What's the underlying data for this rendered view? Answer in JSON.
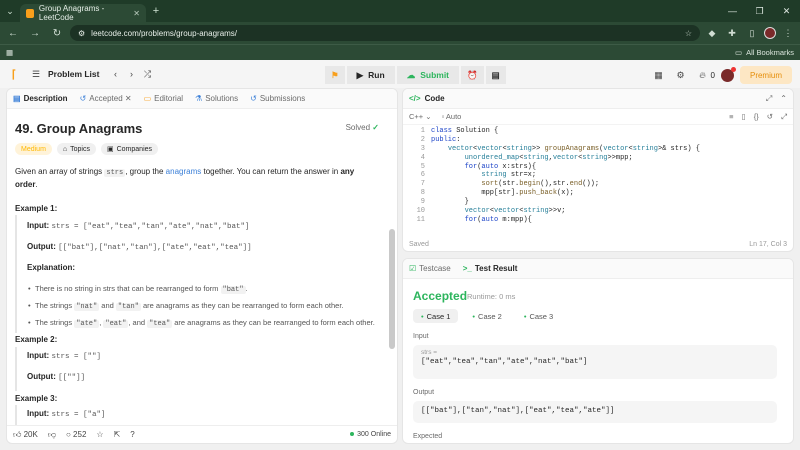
{
  "browser": {
    "tab_title": "Group Anagrams - LeetCode",
    "url": "leetcode.com/problems/group-anagrams/",
    "all_bookmarks": "All Bookmarks"
  },
  "topbar": {
    "problem_list": "Problem List",
    "run": "Run",
    "submit": "Submit",
    "streak": "0",
    "premium": "Premium"
  },
  "left": {
    "tabs": [
      "Description",
      "Accepted",
      "Editorial",
      "Solutions",
      "Submissions"
    ],
    "title": "49. Group Anagrams",
    "solved": "Solved",
    "difficulty": "Medium",
    "topics": "Topics",
    "companies": "Companies",
    "desc_1": "Given an array of strings ",
    "desc_code": "strs",
    "desc_2": ", group the ",
    "desc_link": "anagrams",
    "desc_3": " together. You can return the answer in ",
    "desc_bold": "any order",
    "desc_4": ".",
    "ex1_h": "Example 1:",
    "ex1_input_label": "Input:",
    "ex1_input": "strs = [\"eat\",\"tea\",\"tan\",\"ate\",\"nat\",\"bat\"]",
    "ex1_output_label": "Output:",
    "ex1_output": "[[\"bat\"],[\"nat\",\"tan\"],[\"ate\",\"eat\",\"tea\"]]",
    "ex1_expl": "Explanation:",
    "b1_a": "There is no string in strs that can be rearranged to form ",
    "b1_c": "\"bat\"",
    "b1_b": ".",
    "b2_a": "The strings ",
    "b2_c1": "\"nat\"",
    "b2_m": " and ",
    "b2_c2": "\"tan\"",
    "b2_b": " are anagrams as they can be rearranged to form each other.",
    "b3_a": "The strings ",
    "b3_c1": "\"ate\"",
    "b3_s": ", ",
    "b3_c2": "\"eat\"",
    "b3_m": ", and ",
    "b3_c3": "\"tea\"",
    "b3_b": " are anagrams as they can be rearranged to form each other.",
    "ex2_h": "Example 2:",
    "ex2_input_label": "Input:",
    "ex2_input": "strs = [\"\"]",
    "ex2_output_label": "Output:",
    "ex2_output": "[[\"\"]]",
    "ex3_h": "Example 3:",
    "ex3_input_label": "Input:",
    "ex3_input": "strs = [\"a\"]",
    "likes": "20K",
    "comments": "252",
    "online": "300 Online"
  },
  "code": {
    "title": "Code",
    "language": "C++",
    "mode": "Auto",
    "lines": [
      "class Solution {",
      "public:",
      "    vector<vector<string>> groupAnagrams(vector<string>& strs) {",
      "        unordered_map<string,vector<string>>mpp;",
      "        for(auto x:strs){",
      "            string str=x;",
      "            sort(str.begin(),str.end());",
      "            mpp[str].push_back(x);",
      "        }",
      "        vector<vector<string>>v;",
      "        for(auto m:mpp){"
    ],
    "saved": "Saved",
    "position": "Ln 17, Col 3"
  },
  "result": {
    "tabs": [
      "Testcase",
      "Test Result"
    ],
    "status": "Accepted",
    "runtime": "Runtime: 0 ms",
    "cases": [
      "Case 1",
      "Case 2",
      "Case 3"
    ],
    "input_label": "Input",
    "input_var": "strs =",
    "input_val": "[\"eat\",\"tea\",\"tan\",\"ate\",\"nat\",\"bat\"]",
    "output_label": "Output",
    "output_val": "[[\"bat\"],[\"tan\",\"nat\"],[\"eat\",\"tea\",\"ate\"]]",
    "expected_label": "Expected"
  },
  "colors": {
    "accent": "#2db55d",
    "brand": "#f89f1b",
    "link": "#3c80d8"
  }
}
